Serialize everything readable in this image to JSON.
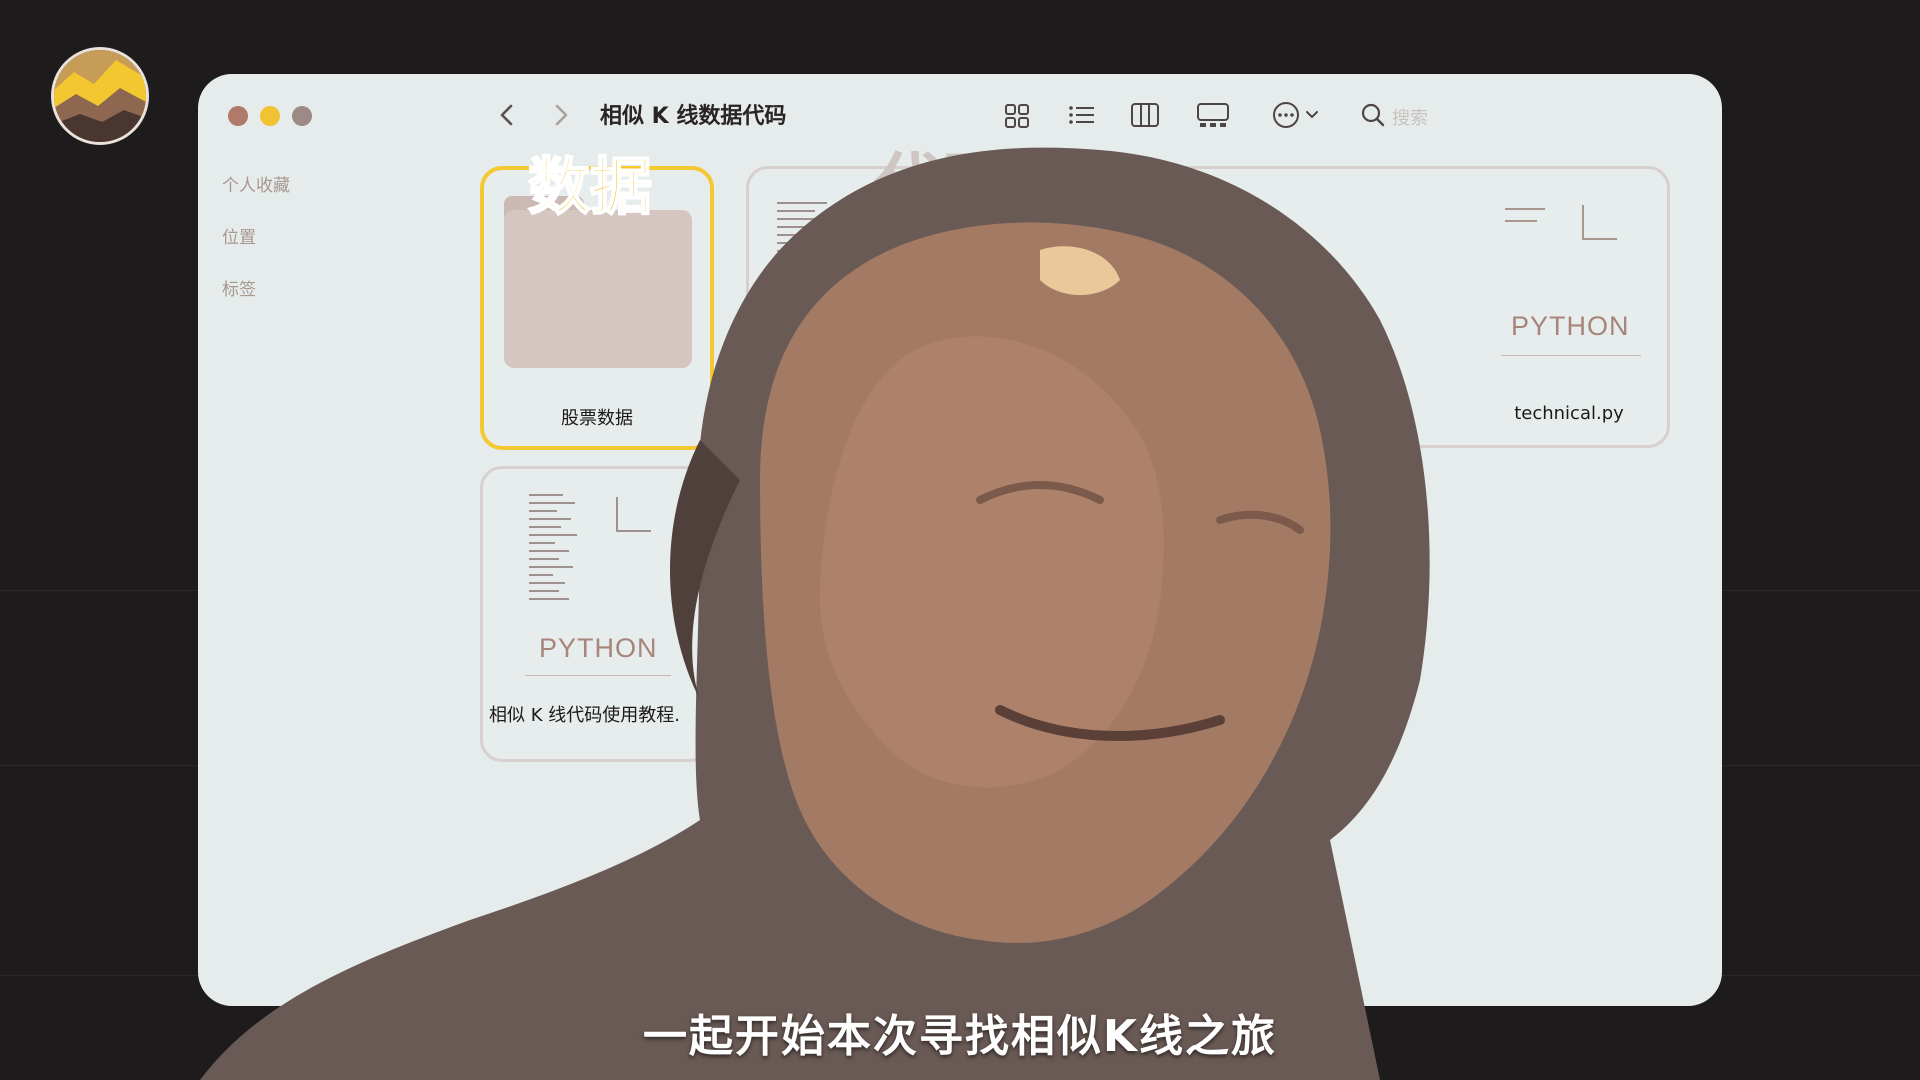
{
  "window": {
    "title": "相似 K 线数据代码",
    "search_placeholder": "搜索"
  },
  "sidebar": {
    "items": [
      {
        "label": "个人收藏"
      },
      {
        "label": "位置"
      },
      {
        "label": "标签"
      }
    ]
  },
  "toolbar": {
    "icons": [
      "back-chevron-icon",
      "forward-chevron-icon",
      "grid-view-icon",
      "list-view-icon",
      "column-view-icon",
      "gallery-view-icon",
      "more-actions-icon",
      "search-icon"
    ]
  },
  "files": [
    {
      "name": "股票数据",
      "kind": "folder",
      "tag": "数据",
      "selected": true
    },
    {
      "name": "technical.py",
      "kind": "python",
      "type_label": "PYTHON",
      "tag": "代码"
    },
    {
      "name": "相似 K 线代码使用教程.",
      "kind": "python",
      "type_label": "PYTHON"
    }
  ],
  "subtitle": "一起开始本次寻找相似K线之旅",
  "colors": {
    "background": "#1e1b1c",
    "window": "#e6ebeb",
    "selection": "#f5c730",
    "traffic_red": "#b07a6a",
    "traffic_yellow": "#f1c232",
    "traffic_gray": "#9b8a85"
  }
}
